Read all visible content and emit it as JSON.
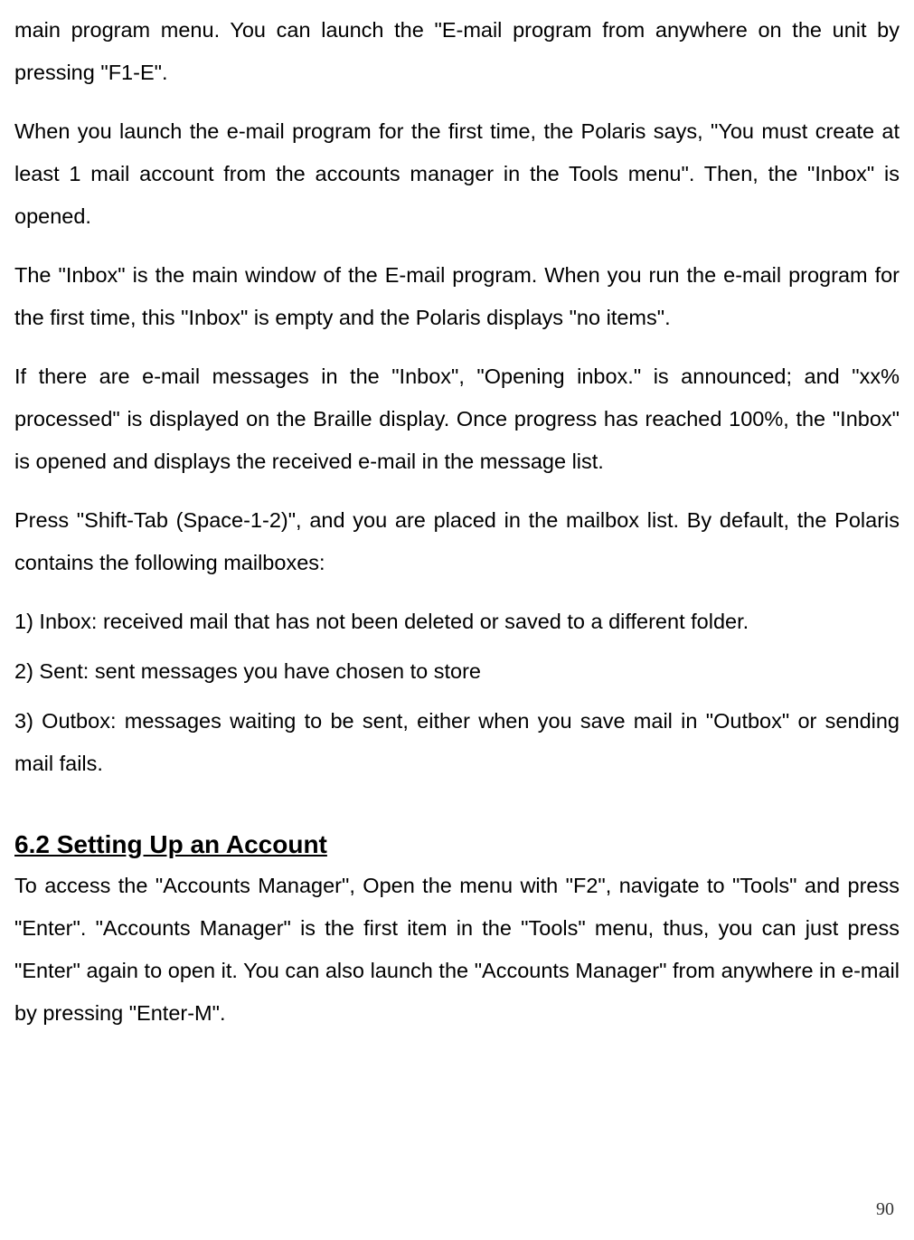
{
  "paragraphs": {
    "p1": "main program menu. You can launch the \"E-mail program from anywhere on the unit by pressing \"F1-E\".",
    "p2": "When you launch the e-mail program for the first time, the Polaris says, \"You must create at least 1 mail account from the accounts manager in the Tools menu\". Then, the \"Inbox\" is opened.",
    "p3": "The \"Inbox\" is the main window of the E-mail program. When you run the e-mail program for the first time, this \"Inbox\" is empty and the Polaris displays \"no items\".",
    "p4": "If there are e-mail messages in the \"Inbox\", \"Opening inbox.\" is announced; and \"xx% processed\" is displayed on the Braille display. Once progress has reached 100%, the \"Inbox\" is opened and displays the received e-mail in the message list.",
    "p5": "Press \"Shift-Tab (Space-1-2)\", and you are placed in the mailbox list. By default, the Polaris contains the following mailboxes:",
    "p6": "1) Inbox: received mail that has not been deleted or saved to a different folder.",
    "p7": "2) Sent: sent messages you have chosen to store",
    "p8": "3) Outbox: messages waiting to be sent, either when you save mail in \"Outbox\" or sending mail fails."
  },
  "heading": "6.2 Setting Up an Account",
  "section2": {
    "p1": "To access the \"Accounts Manager\", Open the menu with \"F2\", navigate to \"Tools\" and press \"Enter\". \"Accounts Manager\" is the first item in the \"Tools\" menu, thus, you can just press \"Enter\" again to open it. You can also launch the \"Accounts Manager\" from anywhere in e-mail by pressing \"Enter-M\"."
  },
  "pageNumber": "90"
}
